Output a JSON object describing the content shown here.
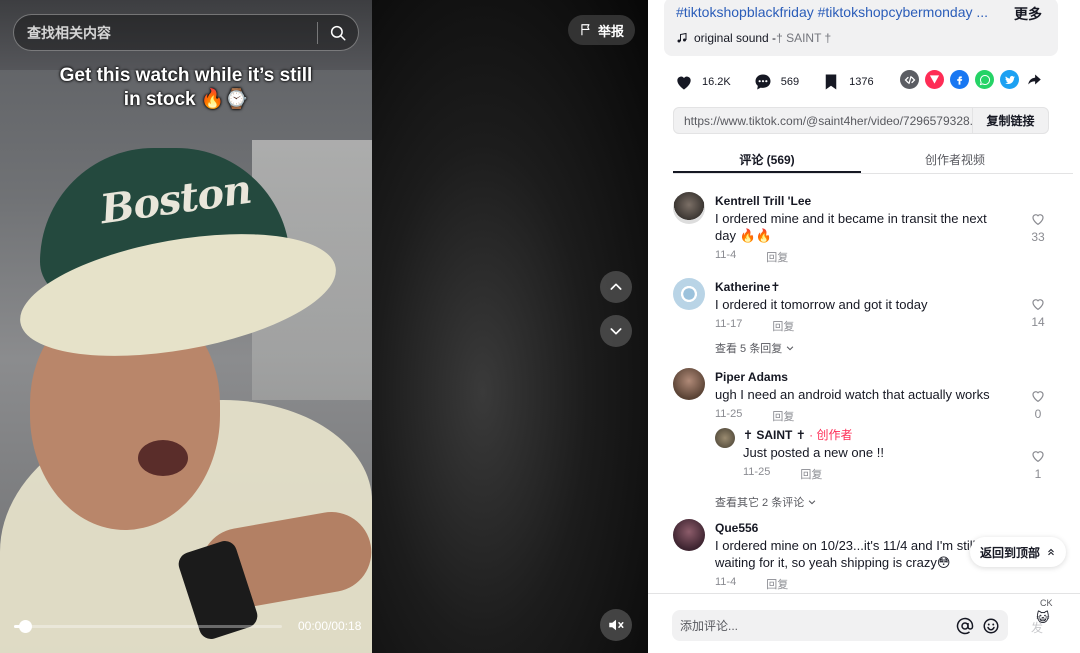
{
  "search": {
    "placeholder": "查找相关内容"
  },
  "video": {
    "caption_line1": "Get this watch while it’s still",
    "caption_line2": "in stock 🔥⌚",
    "cap_text": "Boston",
    "report_label": "举报",
    "time": "00:00/00:18",
    "progress": 0.04
  },
  "description": {
    "hashtags": "#tiktokshopblackfriday #tiktokshopcybermonday ...",
    "more_label": "更多",
    "sound_title": "original sound - ",
    "sound_artist": "† SAINT †"
  },
  "stats": {
    "likes": "16.2K",
    "comments": "569",
    "saves": "1376"
  },
  "link": {
    "url": "https://www.tiktok.com/@saint4her/video/7296579328...",
    "copy_label": "复制链接"
  },
  "tabs": [
    {
      "label": "评论 (569)",
      "active": true
    },
    {
      "label": "创作者视频",
      "active": false
    }
  ],
  "comments": [
    {
      "name": "Kentrell Trill 'Lee",
      "text": "I ordered mine and it became in transit the next day 🔥🔥",
      "date": "11-4",
      "reply_label": "回复",
      "likes": "33"
    },
    {
      "name": "Katherine✝",
      "text": "I ordered it tomorrow and got it today",
      "date": "11-17",
      "reply_label": "回复",
      "likes": "14",
      "more_replies": "查看 5 条回复"
    },
    {
      "name": "Piper Adams",
      "text": "ugh I need an android watch that actually works",
      "date": "11-25",
      "reply_label": "回复",
      "likes": "0",
      "more_replies": "查看其它 2 条评论",
      "reply": {
        "name": "✝ SAINT ✝",
        "creator_tag": "· 创作者",
        "text": "Just posted a new one !!",
        "date": "11-25",
        "reply_label": "回复",
        "likes": "1"
      }
    },
    {
      "name": "Que556",
      "text": "I ordered mine on 10/23...it's 11/4 and I'm still waiting for it, so yeah shipping is crazy😳",
      "date": "11-4",
      "reply_label": "回复"
    }
  ],
  "back_to_top": "返回到顶部",
  "comment_bar": {
    "placeholder": "添加评论...",
    "post_label": "发",
    "lang": "CK"
  },
  "colors": {
    "accent": "#fe2c55",
    "hashtag": "#2b5db9"
  }
}
